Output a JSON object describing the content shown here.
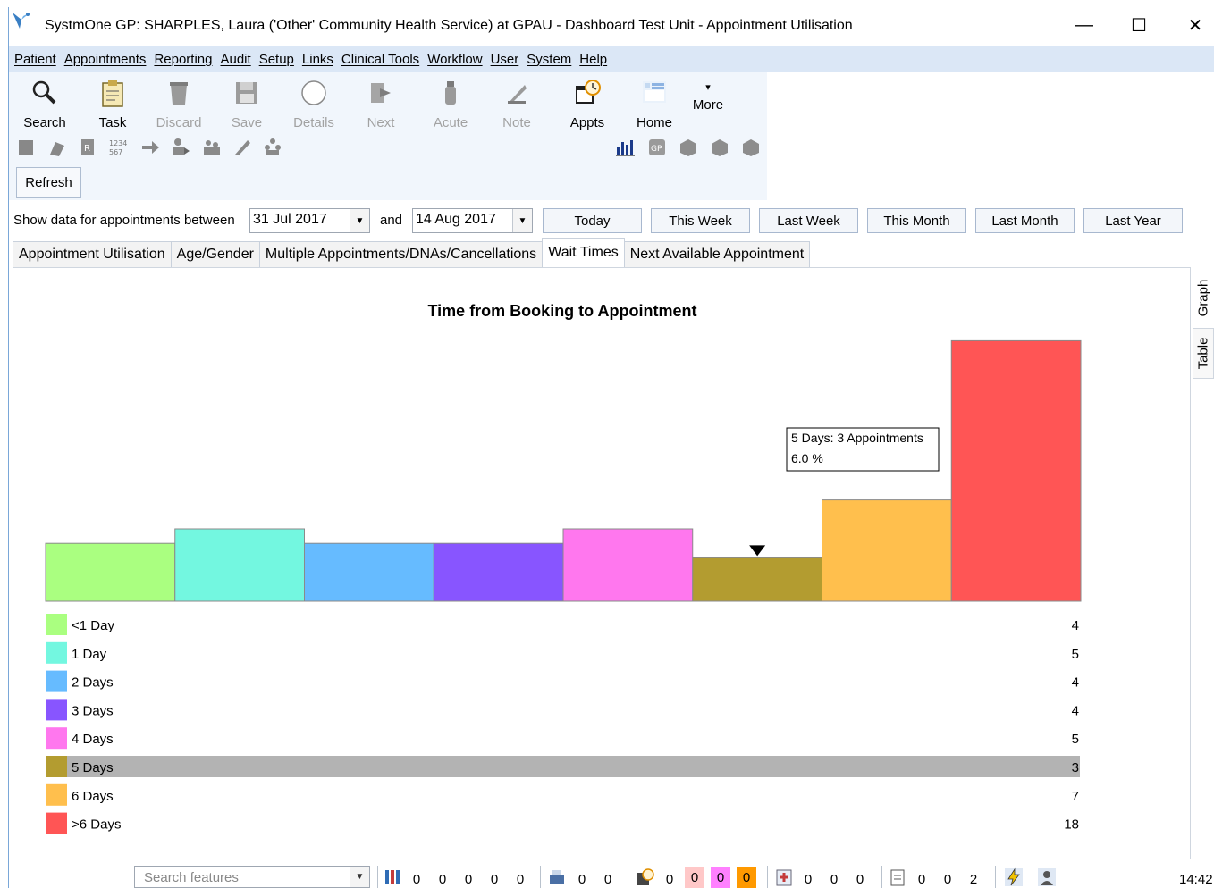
{
  "window": {
    "title": "SystmOne GP: SHARPLES, Laura ('Other' Community Health Service) at GPAU - Dashboard Test Unit - Appointment Utilisation",
    "minimize": "—",
    "maximize": "☐",
    "close": "✕"
  },
  "menu": [
    "Patient",
    "Appointments",
    "Reporting",
    "Audit",
    "Setup",
    "Links",
    "Clinical Tools",
    "Workflow",
    "User",
    "System",
    "Help"
  ],
  "toolbar": {
    "search": "Search",
    "task": "Task",
    "discard": "Discard",
    "save": "Save",
    "details": "Details",
    "next": "Next",
    "acute": "Acute",
    "note": "Note",
    "appts": "Appts",
    "home": "Home",
    "more": "More",
    "refresh": "Refresh"
  },
  "date_filter": {
    "label": "Show data for appointments between",
    "from": "31 Jul 2017",
    "and": "and",
    "to": "14 Aug 2017",
    "ranges": [
      "Today",
      "This Week",
      "Last Week",
      "This Month",
      "Last Month",
      "Last Year"
    ]
  },
  "tabs": [
    "Appointment Utilisation",
    "Age/Gender",
    "Multiple Appointments/DNAs/Cancellations",
    "Wait Times",
    "Next Available Appointment"
  ],
  "active_tab": "Wait Times",
  "side_tabs": [
    "Graph",
    "Table"
  ],
  "chart_data": {
    "type": "bar",
    "title": "Time from Booking to Appointment",
    "categories": [
      "<1 Day",
      "1 Day",
      "2 Days",
      "3 Days",
      "4 Days",
      "5 Days",
      "6 Days",
      ">6 Days"
    ],
    "values": [
      4,
      5,
      4,
      4,
      5,
      3,
      7,
      18
    ],
    "colors": [
      "#aaff80",
      "#73f7e0",
      "#66bbff",
      "#8855ff",
      "#ff77ee",
      "#b39c30",
      "#ffbf4d",
      "#ff5555"
    ],
    "highlighted_index": 5,
    "tooltip": {
      "line1": "5 Days: 3 Appointments",
      "line2": "6.0 %"
    },
    "highlight_color": "#b3b3b3"
  },
  "status": {
    "search_placeholder": "Search features",
    "group1": [
      "0",
      "0",
      "0",
      "0",
      "0"
    ],
    "group2": [
      "0",
      "0"
    ],
    "group3_plain": "0",
    "group3_boxes": [
      "0",
      "0",
      "0"
    ],
    "group3_box_colors": [
      "#ffc8c8",
      "#ff80ff",
      "#ff9900"
    ],
    "group4": [
      "0",
      "0",
      "0"
    ],
    "group5": [
      "0",
      "0",
      "2"
    ],
    "time": "14:42"
  }
}
